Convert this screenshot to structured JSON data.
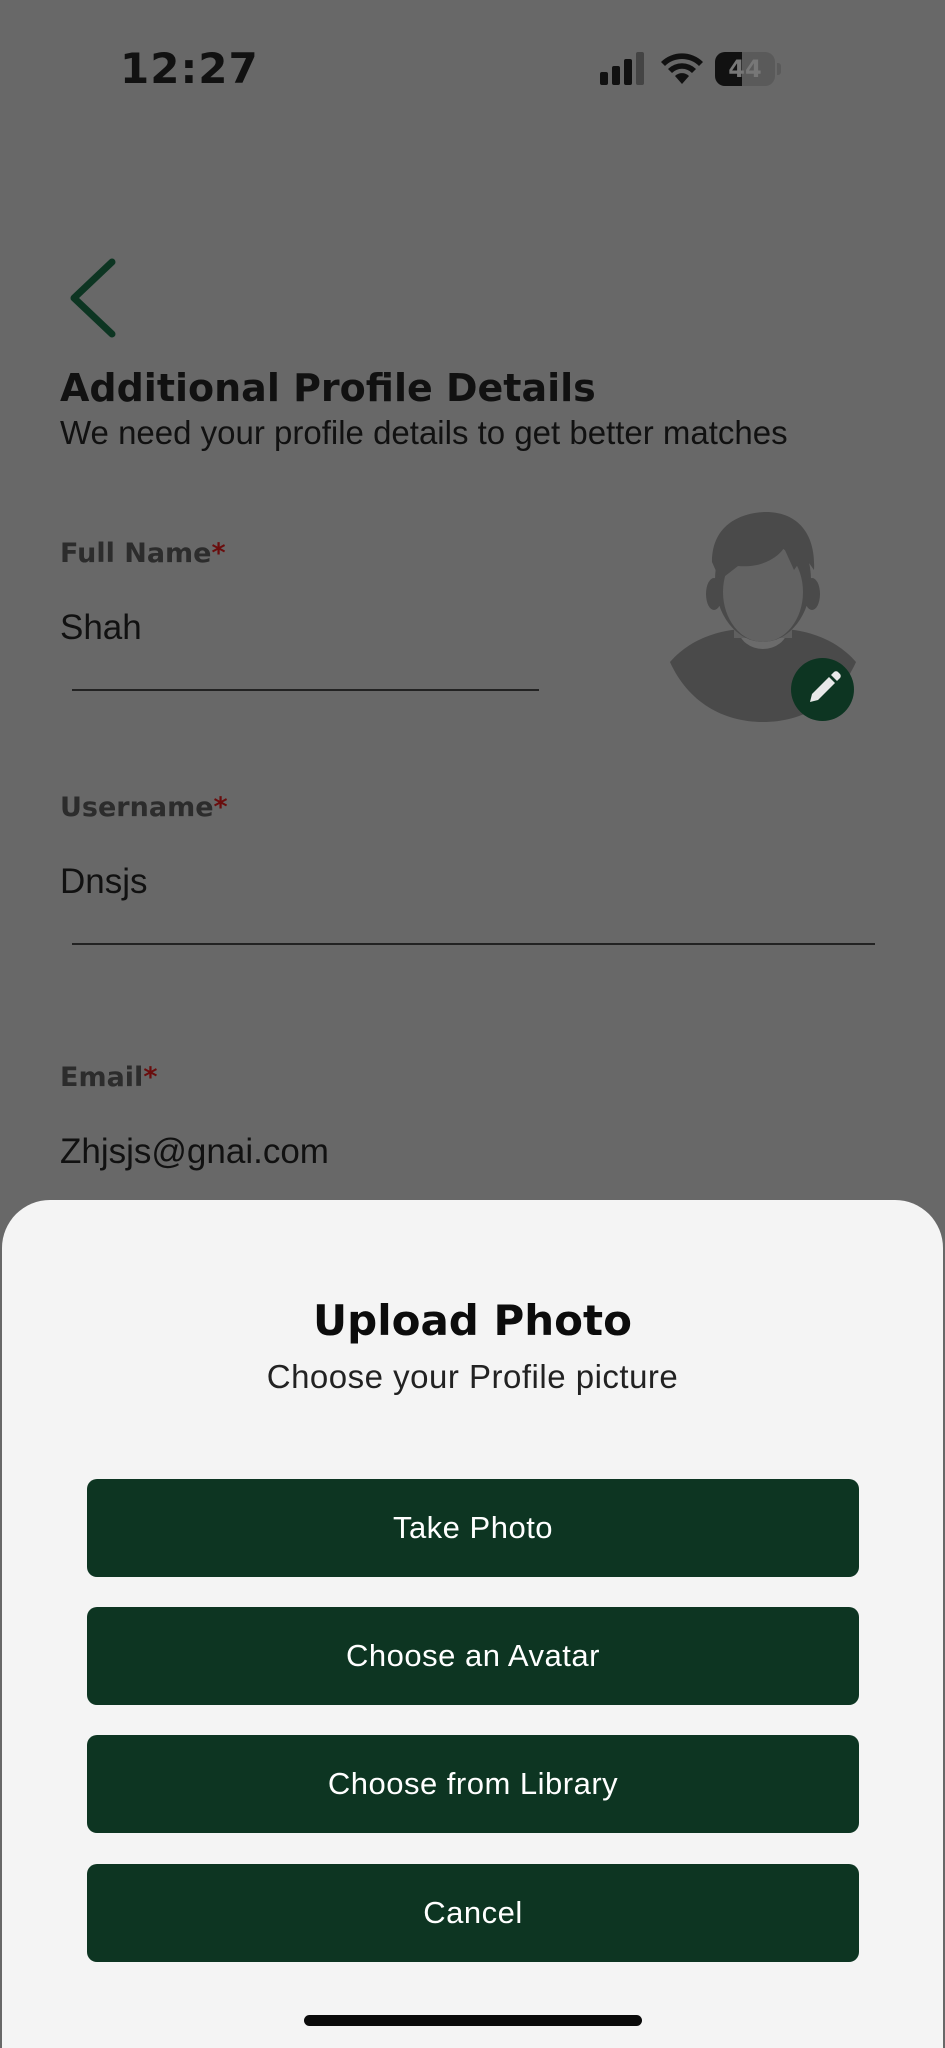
{
  "status_bar": {
    "time": "12:27",
    "battery": "44"
  },
  "header": {
    "title": "Additional Profile Details",
    "subtitle": "We need your profile details to get better matches"
  },
  "form": {
    "required_mark": "*",
    "full_name": {
      "label": "Full Name",
      "value": "Shah"
    },
    "username": {
      "label": "Username",
      "value": "Dnsjs"
    },
    "email": {
      "label": "Email",
      "value": "Zhjsjs@gnai.com"
    }
  },
  "sheet": {
    "title": "Upload Photo",
    "subtitle": "Choose your Profile picture",
    "buttons": {
      "take_photo": "Take Photo",
      "choose_avatar": "Choose an Avatar",
      "choose_library": "Choose from Library",
      "cancel": "Cancel"
    }
  },
  "colors": {
    "overlay_background": "#686868",
    "accent_green": "#0d3522",
    "sheet_background": "#f4f4f4",
    "required_red": "#6a0d0d"
  },
  "icons": [
    "signal-icon",
    "wifi-icon",
    "battery-icon",
    "back-chevron-icon",
    "avatar-placeholder-icon",
    "pencil-icon"
  ]
}
